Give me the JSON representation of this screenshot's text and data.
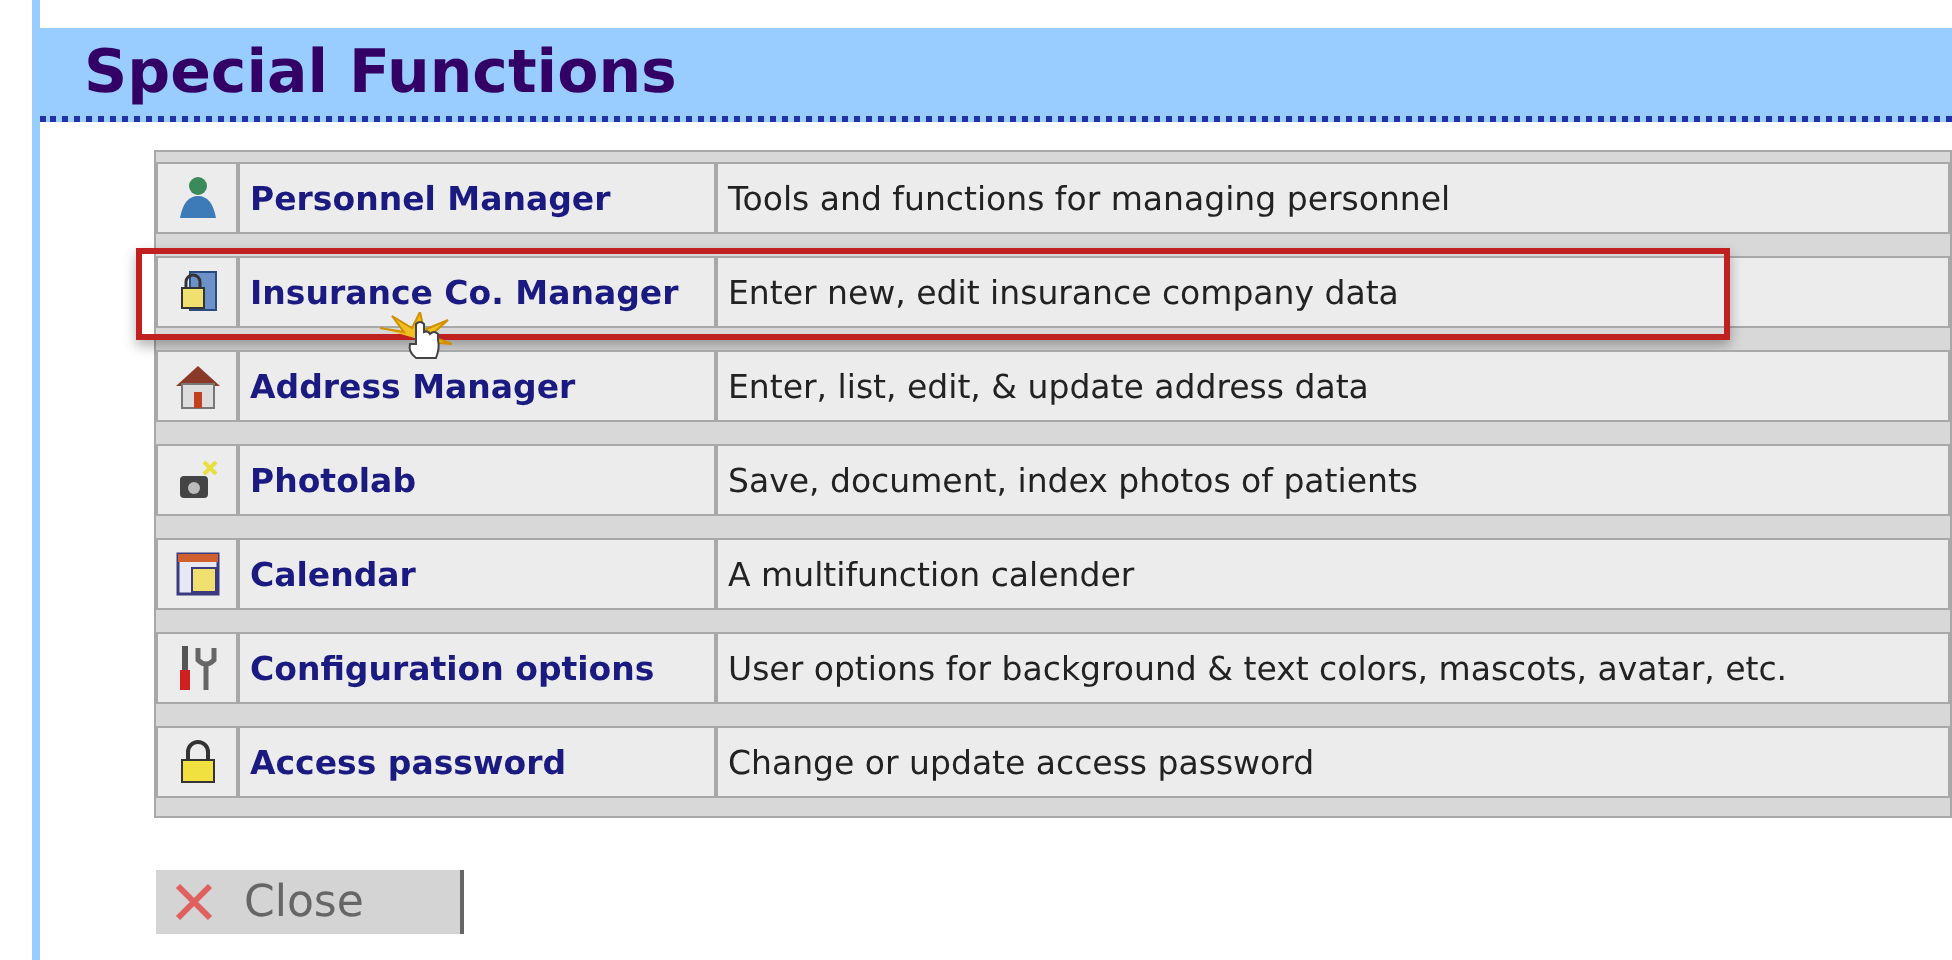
{
  "page": {
    "title": "Special Functions"
  },
  "functions": [
    {
      "kind": "person",
      "name": "Personnel Manager",
      "description": "Tools and functions for managing personnel",
      "highlighted": false,
      "pointer": false
    },
    {
      "kind": "folder-lock",
      "name": "Insurance Co. Manager",
      "description": "Enter new, edit insurance company data",
      "highlighted": true,
      "pointer": true
    },
    {
      "kind": "house",
      "name": "Address Manager",
      "description": "Enter, list, edit, & update address data",
      "highlighted": false,
      "pointer": false
    },
    {
      "kind": "camera",
      "name": "Photolab",
      "description": "Save, document, index photos of patients",
      "highlighted": false,
      "pointer": false
    },
    {
      "kind": "calendar",
      "name": "Calendar",
      "description": "A multifunction calender",
      "highlighted": false,
      "pointer": false
    },
    {
      "kind": "tools",
      "name": "Configuration options",
      "description": "User options for background & text colors, mascots, avatar, etc.",
      "highlighted": false,
      "pointer": false
    },
    {
      "kind": "padlock",
      "name": "Access password",
      "description": "Change or update access password",
      "highlighted": false,
      "pointer": false
    }
  ],
  "close_button": {
    "label": "Close"
  }
}
